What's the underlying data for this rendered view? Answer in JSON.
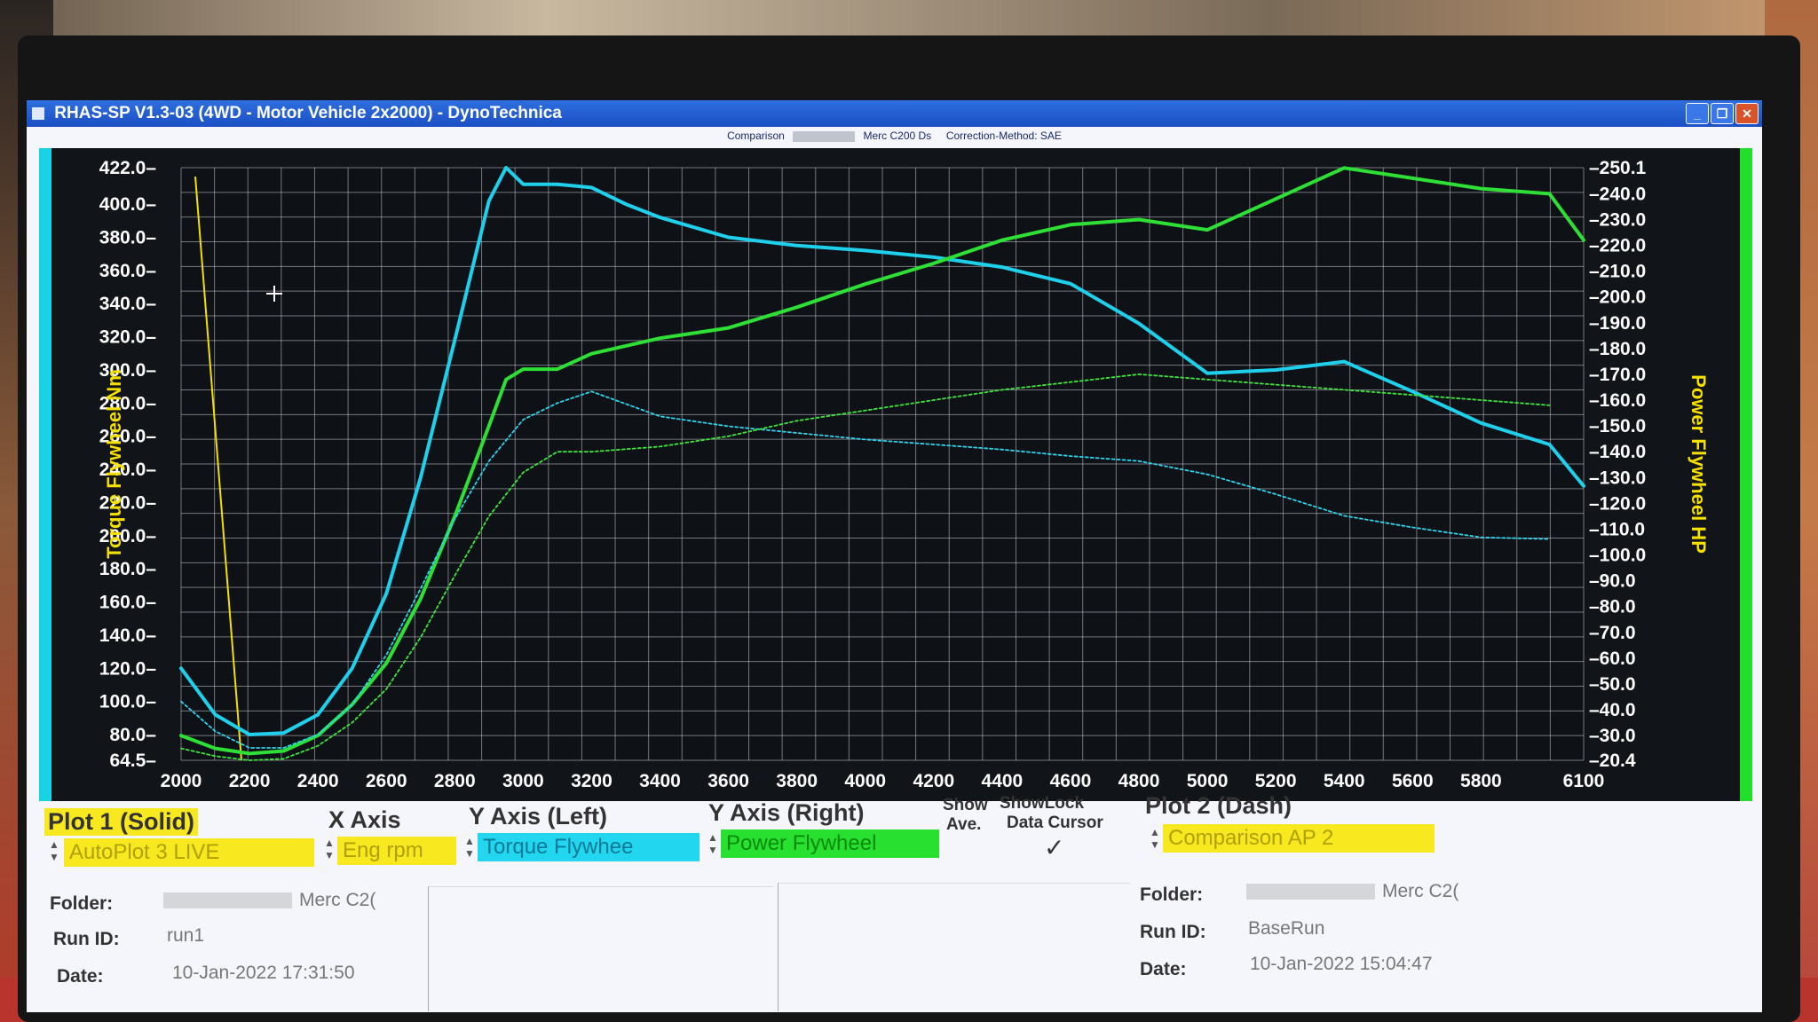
{
  "window": {
    "title": "RHAS-SP V1.3-03  (4WD - Motor Vehicle 2x2000) - DynoTechnica",
    "buttons": [
      "_",
      "❐",
      "✕"
    ]
  },
  "subheader": {
    "comparison_label": "Comparison",
    "vehicle": "Merc C200 Ds",
    "correction": "Correction-Method: SAE"
  },
  "chart_data": {
    "type": "line",
    "xlabel": "",
    "ylabel_left": "Torque Flywheel Nm",
    "ylabel_right": "Power Flywheel HP",
    "xlim": [
      2000,
      6100
    ],
    "ylim_left": [
      64.5,
      422.0
    ],
    "ylim_right": [
      20.4,
      250.1
    ],
    "x_ticks": [
      "2000",
      "2200",
      "2400",
      "2600",
      "2800",
      "3000",
      "3200",
      "3400",
      "3600",
      "3800",
      "4000",
      "4200",
      "4400",
      "4600",
      "4800",
      "5000",
      "5200",
      "5400",
      "5600",
      "5800",
      "6100"
    ],
    "y_left_ticks": [
      "422.0",
      "400.0",
      "380.0",
      "360.0",
      "340.0",
      "320.0",
      "300.0",
      "280.0",
      "260.0",
      "240.0",
      "220.0",
      "200.0",
      "180.0",
      "160.0",
      "140.0",
      "120.0",
      "100.0",
      "80.0",
      "64.5"
    ],
    "y_right_ticks": [
      "250.1",
      "240.0",
      "230.0",
      "220.0",
      "210.0",
      "200.0",
      "190.0",
      "180.0",
      "170.0",
      "160.0",
      "150.0",
      "140.0",
      "130.0",
      "120.0",
      "110.0",
      "100.0",
      "90.0",
      "80.0",
      "70.0",
      "60.0",
      "50.0",
      "40.0",
      "30.0",
      "20.4"
    ],
    "grid": true,
    "series": [
      {
        "name": "Torque Flywheel",
        "axis": "left",
        "style": "solid",
        "color": "#1ed0ec",
        "x": [
          2000,
          2100,
          2200,
          2300,
          2400,
          2500,
          2600,
          2700,
          2800,
          2900,
          2950,
          3000,
          3100,
          3200,
          3300,
          3400,
          3600,
          3800,
          4000,
          4200,
          4400,
          4600,
          4800,
          5000,
          5200,
          5400,
          5600,
          5800,
          6000,
          6100
        ],
        "y": [
          120,
          92,
          80,
          81,
          92,
          120,
          165,
          235,
          318,
          402,
          422,
          412,
          412,
          410,
          400,
          392,
          380,
          375,
          372,
          368,
          362,
          352,
          328,
          298,
          300,
          305,
          287,
          268,
          255,
          230
        ]
      },
      {
        "name": "Power Flywheel",
        "axis": "right",
        "style": "solid",
        "color": "#2ee035",
        "x": [
          2000,
          2100,
          2200,
          2300,
          2400,
          2500,
          2600,
          2700,
          2800,
          2900,
          2950,
          3000,
          3100,
          3200,
          3400,
          3600,
          3800,
          4000,
          4200,
          4400,
          4600,
          4800,
          5000,
          5200,
          5400,
          5600,
          5800,
          6000,
          6100
        ],
        "y": [
          30,
          25,
          23,
          24,
          30,
          42,
          58,
          83,
          115,
          150,
          168,
          172,
          172,
          178,
          184,
          188,
          196,
          205,
          213,
          222,
          228,
          230,
          226,
          238,
          250,
          246,
          242,
          240,
          222
        ]
      },
      {
        "name": "Comparison Torque Flywheel",
        "axis": "left",
        "style": "dash",
        "color": "#2ad6ee",
        "x": [
          2000,
          2100,
          2200,
          2300,
          2400,
          2500,
          2600,
          2700,
          2800,
          2900,
          3000,
          3100,
          3200,
          3400,
          3600,
          3800,
          4000,
          4200,
          4400,
          4600,
          4800,
          5000,
          5200,
          5400,
          5600,
          5800,
          6000
        ],
        "y": [
          100,
          82,
          72,
          72,
          80,
          98,
          128,
          168,
          210,
          245,
          270,
          280,
          287,
          272,
          266,
          262,
          258,
          255,
          252,
          248,
          245,
          237,
          225,
          212,
          205,
          199,
          198
        ]
      },
      {
        "name": "Comparison Power Flywheel",
        "axis": "right",
        "style": "dash",
        "color": "#3be83a",
        "x": [
          2000,
          2100,
          2200,
          2300,
          2400,
          2500,
          2600,
          2700,
          2800,
          2900,
          3000,
          3100,
          3200,
          3400,
          3600,
          3800,
          4000,
          4200,
          4400,
          4600,
          4800,
          5000,
          5200,
          5400,
          5600,
          5800,
          6000
        ],
        "y": [
          25,
          22,
          20.4,
          21,
          26,
          35,
          48,
          68,
          92,
          115,
          132,
          140,
          140,
          142,
          146,
          152,
          156,
          160,
          164,
          167,
          170,
          168,
          166,
          164,
          162,
          160,
          158
        ]
      }
    ]
  },
  "panel": {
    "plot1_label": "Plot 1 (Solid)",
    "x_axis_label": "X Axis",
    "y_left_label": "Y Axis (Left)",
    "y_right_label": "Y Axis (Right)",
    "show_ave_label_1": "Show",
    "show_ave_label_2": "Ave.",
    "showlock_label_1": "ShowLock",
    "showlock_label_2": "Data Cursor",
    "plot2_label": "Plot 2 (Dash)",
    "plot1_select": "AutoPlot 3 LIVE",
    "x_axis_select": "Eng rpm",
    "y_left_select": "Torque Flywhee",
    "y_right_select": "Power Flywheel",
    "plot2_select": "Comparison AP 2",
    "check_mark": "✓",
    "plot1_folder_label": "Folder:",
    "plot1_folder_value": "Merc C2(",
    "plot1_runid_label": "Run ID:",
    "plot1_runid_value": "run1",
    "plot1_date_label": "Date:",
    "plot1_date_value": "10-Jan-2022   17:31:50",
    "plot2_folder_label": "Folder:",
    "plot2_folder_value": "Merc C2(",
    "plot2_runid_label": "Run ID:",
    "plot2_runid_value": "BaseRun",
    "plot2_date_label": "Date:",
    "plot2_date_value": "10-Jan-2022   15:04:47"
  }
}
